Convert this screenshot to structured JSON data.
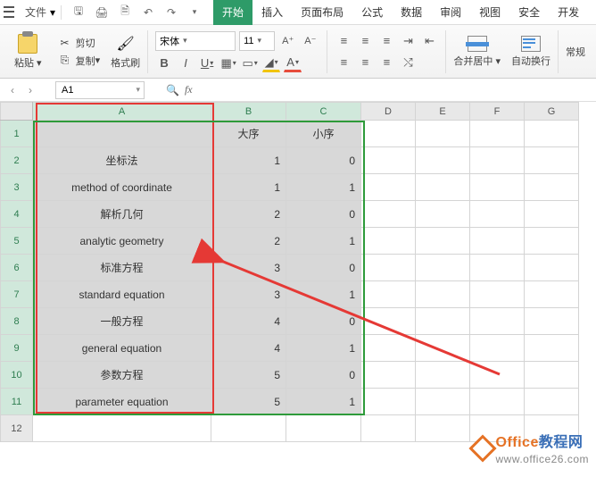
{
  "titlebar": {
    "file_label": "文件"
  },
  "tabs": {
    "start": "开始",
    "insert": "插入",
    "layout": "页面布局",
    "formula": "公式",
    "data": "数据",
    "review": "审阅",
    "view": "视图",
    "security": "安全",
    "dev": "开发"
  },
  "ribbon": {
    "paste": "粘贴",
    "cut": "剪切",
    "copy": "复制",
    "format_painter": "格式刷",
    "font_name": "宋体",
    "font_size": "11",
    "merge_center": "合并居中",
    "wrap_text": "自动换行",
    "general": "常规"
  },
  "namebox": {
    "cell_ref": "A1",
    "fx": "fx"
  },
  "grid": {
    "columns": [
      "A",
      "B",
      "C",
      "D",
      "E",
      "F",
      "G"
    ],
    "row_numbers": [
      1,
      2,
      3,
      4,
      5,
      6,
      7,
      8,
      9,
      10,
      11,
      12
    ],
    "headers": {
      "B": "大序",
      "C": "小序"
    },
    "rows": [
      {
        "A": "坐标法",
        "B": 1,
        "C": 0
      },
      {
        "A": "method of coordinate",
        "B": 1,
        "C": 1
      },
      {
        "A": "解析几何",
        "B": 2,
        "C": 0
      },
      {
        "A": "analytic geometry",
        "B": 2,
        "C": 1
      },
      {
        "A": "标准方程",
        "B": 3,
        "C": 0
      },
      {
        "A": "standard equation",
        "B": 3,
        "C": 1
      },
      {
        "A": "一般方程",
        "B": 4,
        "C": 0
      },
      {
        "A": "general equation",
        "B": 4,
        "C": 1
      },
      {
        "A": "参数方程",
        "B": 5,
        "C": 0
      },
      {
        "A": "parameter  equation",
        "B": 5,
        "C": 1
      }
    ]
  },
  "watermark": {
    "brand": "Office",
    "suffix": "教程网",
    "url": "www.office26.com"
  }
}
